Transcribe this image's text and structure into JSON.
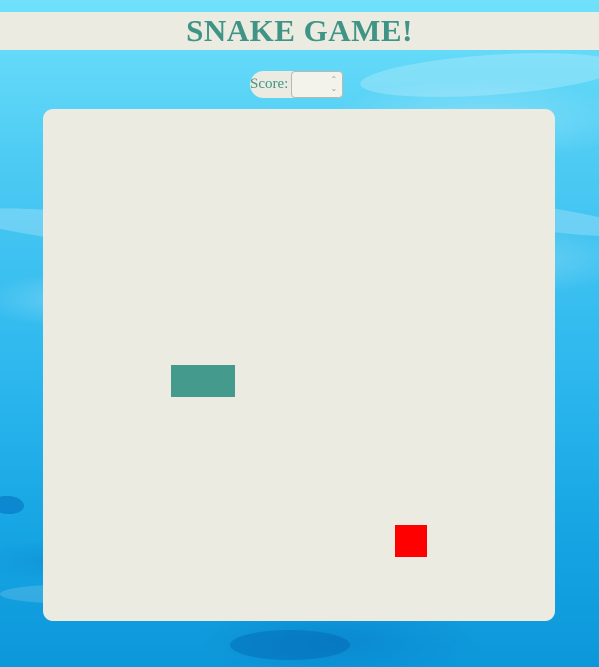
{
  "header": {
    "title": "SNAKE GAME!"
  },
  "score": {
    "label": "Score:",
    "value": ""
  },
  "game": {
    "grid_size": 16,
    "snake_color": "#449b8d",
    "food_color": "#ff0000",
    "board_color": "#ebebe1",
    "snake_cells": [
      [
        4,
        8
      ],
      [
        5,
        8
      ]
    ],
    "food_cell": [
      11,
      13
    ]
  }
}
